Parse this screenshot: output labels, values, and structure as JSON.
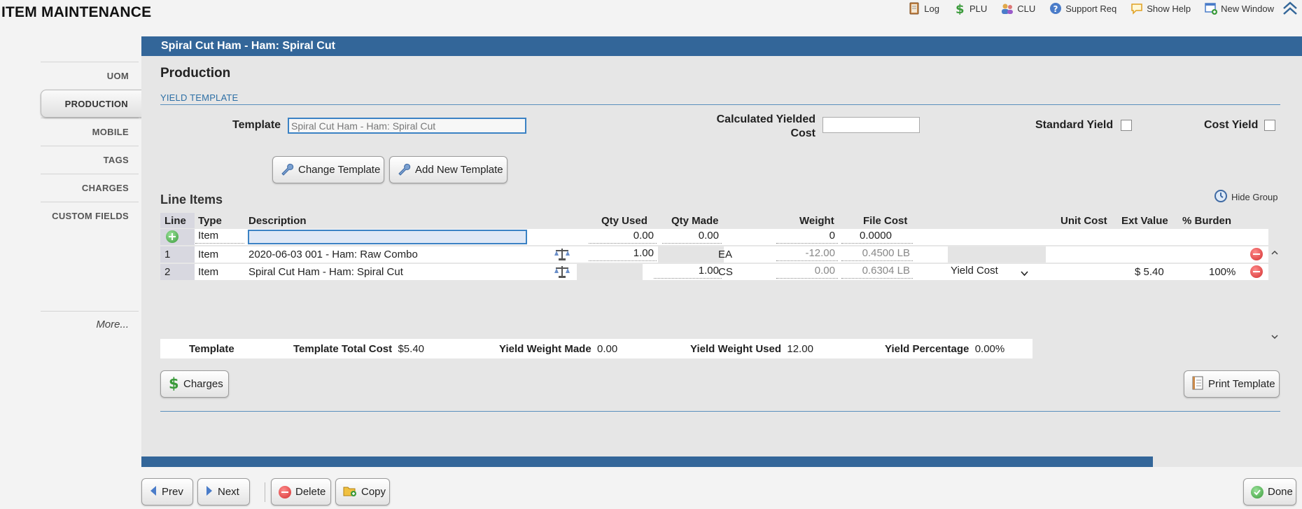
{
  "app": {
    "title": "ITEM MAINTENANCE"
  },
  "toplinks": [
    {
      "label": "Log",
      "icon": "log-book-icon"
    },
    {
      "label": "PLU",
      "icon": "dollar-icon"
    },
    {
      "label": "CLU",
      "icon": "users-icon"
    },
    {
      "label": "Support Req",
      "icon": "help-circle-icon"
    },
    {
      "label": "Show Help",
      "icon": "speech-bubble-icon"
    },
    {
      "label": "New Window",
      "icon": "new-window-icon"
    }
  ],
  "nav": {
    "items": [
      "UOM",
      "PRODUCTION",
      "MOBILE",
      "TAGS",
      "CHARGES",
      "CUSTOM FIELDS"
    ],
    "active": "PRODUCTION",
    "more": "More..."
  },
  "item": {
    "header": "Spiral Cut Ham - Ham: Spiral Cut"
  },
  "section": {
    "title": "Production",
    "yield_template": "YIELD TEMPLATE",
    "template_label": "Template",
    "template_value": "Spiral Cut Ham - Ham: Spiral Cut",
    "calc_cost_label_1": "Calculated Yielded",
    "calc_cost_label_2": "Cost",
    "calc_cost_value": "",
    "standard_yield_label": "Standard Yield",
    "cost_yield_label": "Cost Yield",
    "change_template": "Change Template",
    "add_new_template": "Add New Template"
  },
  "line_items": {
    "title": "Line Items",
    "hide_group": "Hide Group",
    "columns": [
      "Line",
      "Type",
      "Description",
      "Qty Used",
      "Qty Made",
      "Weight",
      "File Cost",
      "Unit Cost",
      "Ext Value",
      "% Burden"
    ],
    "new_row": {
      "type": "Item",
      "qty_used": "0.00",
      "qty_made": "0.00",
      "weight": "0",
      "file_cost": "0.0000"
    },
    "rows": [
      {
        "line": "1",
        "type": "Item",
        "description": "2020-06-03 001 - Ham: Raw Combo",
        "qty_used": "1.00",
        "qty_made": "",
        "uom": "EA",
        "weight": "-12.00",
        "file_cost": "0.4500 LB",
        "yield": "",
        "unit_cost": "",
        "ext_value": "",
        "burden": ""
      },
      {
        "line": "2",
        "type": "Item",
        "description": "Spiral Cut Ham - Ham: Spiral Cut",
        "qty_used": "",
        "qty_made": "1.00",
        "uom": "CS",
        "weight": "0.00",
        "file_cost": "0.6304 LB",
        "yield": "Yield Cost",
        "unit_cost": "",
        "ext_value": "$ 5.40",
        "burden": "100%"
      }
    ]
  },
  "summary": {
    "template": "Template",
    "total_cost_label": "Template Total Cost",
    "total_cost": "$5.40",
    "weight_made_label": "Yield Weight Made",
    "weight_made": "0.00",
    "weight_used_label": "Yield Weight Used",
    "weight_used": "12.00",
    "percentage_label": "Yield Percentage",
    "percentage": "0.00%"
  },
  "buttons": {
    "charges": "Charges",
    "print_template": "Print Template",
    "prev": "Prev",
    "next": "Next",
    "delete": "Delete",
    "copy": "Copy",
    "done": "Done"
  },
  "colors": {
    "brand_blue": "#336699",
    "link_blue": "#2d6fa5"
  }
}
